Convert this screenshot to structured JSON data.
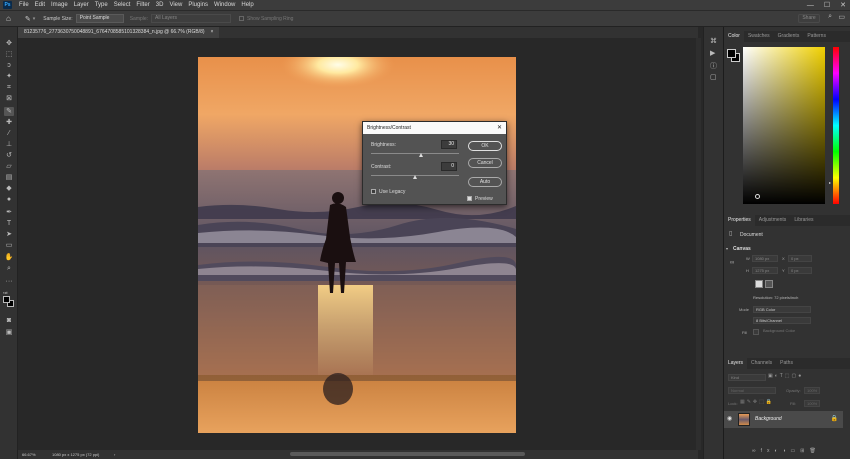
{
  "menubar": {
    "app_icon": "Ps",
    "items": [
      "File",
      "Edit",
      "Image",
      "Layer",
      "Type",
      "Select",
      "Filter",
      "3D",
      "View",
      "Plugins",
      "Window",
      "Help"
    ]
  },
  "window_controls": {
    "minimize": "—",
    "maximize": "☐",
    "close": "✕"
  },
  "options": {
    "sample_size_label": "Sample Size:",
    "sample_size_value": "Point Sample",
    "sample_label": "Sample:",
    "sample_value": "All Layers",
    "show_ring_label": "Show Sampling Ring",
    "share": "Share"
  },
  "doc_tab": {
    "title": "81235776_2773630750048891_6764708585101328384_n.jpg @ 66.7% (RGB/8)",
    "close": "×"
  },
  "status": {
    "zoom": "66.67%",
    "size": "1080 px x 1275 px (72 ppi)",
    "arrow": "›"
  },
  "dialog": {
    "title": "Brightness/Contrast",
    "close": "✕",
    "brightness_label": "Brightness:",
    "brightness_value": "30",
    "brightness_level": 0.565,
    "contrast_label": "Contrast:",
    "contrast_value": "0",
    "contrast_level": 0.5,
    "use_legacy_label": "Use Legacy",
    "use_legacy_checked": false,
    "preview_label": "Preview",
    "preview_checked": true,
    "ok_label": "OK",
    "cancel_label": "Cancel",
    "auto_label": "Auto"
  },
  "color_panel": {
    "tabs": [
      "Color",
      "Swatches",
      "Gradients",
      "Patterns"
    ],
    "active": "Color"
  },
  "properties_panel": {
    "tabs": [
      "Properties",
      "Adjustments",
      "Libraries"
    ],
    "active": "Properties",
    "doc_label": "Document",
    "section": "Canvas",
    "w_label": "W",
    "w_value": "1080 px",
    "h_label": "H",
    "h_value": "1275 px",
    "x_label": "X",
    "x_value": "0 px",
    "y_label": "Y",
    "y_value": "0 px",
    "resolution": "Resolution: 72 pixels/inch",
    "mode_label": "Mode",
    "mode_value": "RGB Color",
    "depth_value": "8 Bits/Channel",
    "fill_label": "Fill",
    "fill_value": "Background Color"
  },
  "layers_panel": {
    "tabs": [
      "Layers",
      "Channels",
      "Paths"
    ],
    "active": "Layers",
    "kind_label": "Kind",
    "blend_value": "Normal",
    "opacity_label": "Opacity:",
    "opacity_value": "100%",
    "lock_label": "Lock:",
    "fill_label": "Fill:",
    "fill_value": "100%",
    "layer_name": "Background"
  },
  "colors": {
    "accent": "#31a8ff",
    "panel": "#323232",
    "bg": "#282828"
  }
}
